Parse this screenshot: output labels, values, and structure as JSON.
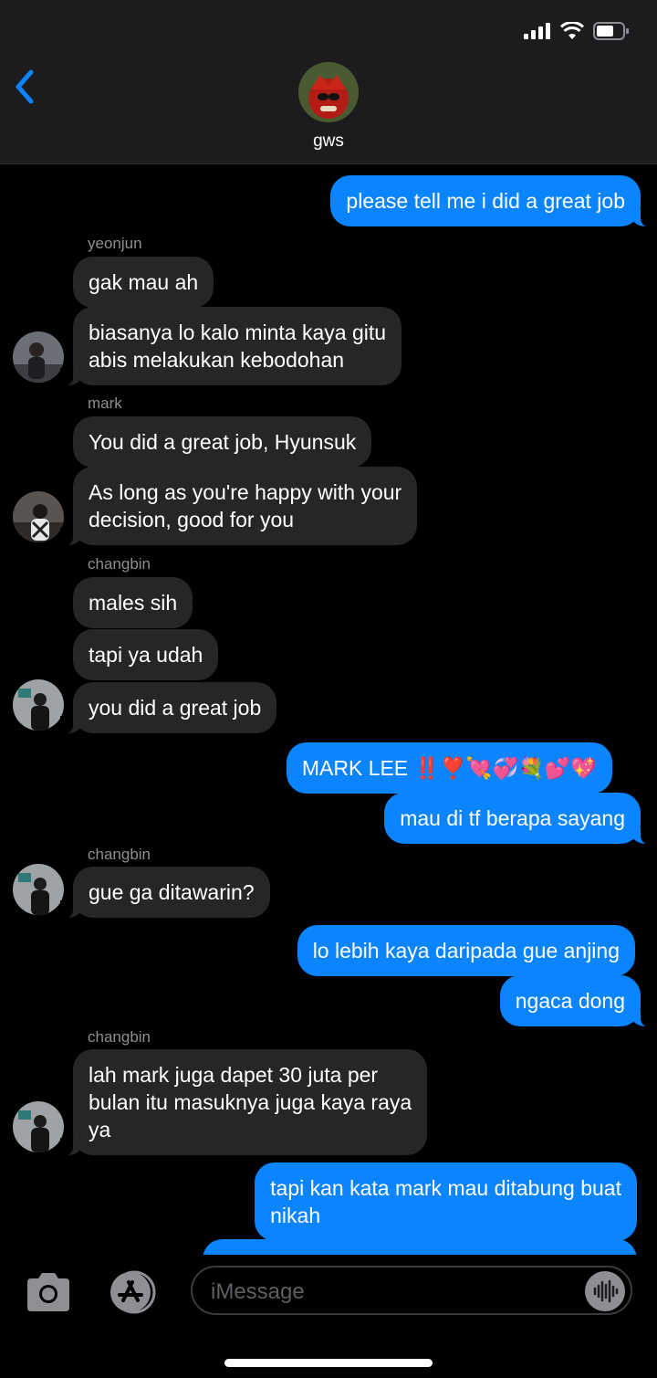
{
  "header": {
    "title": "gws",
    "back_icon": "chevron-left-icon",
    "avatar": "group-avatar-image"
  },
  "status": {
    "signal": "signal-icon",
    "wifi": "wifi-icon",
    "battery": "battery-icon"
  },
  "colors": {
    "sent_bubble": "#0a84ff",
    "received_bubble": "#262629",
    "background": "#000000",
    "header_bg": "#1c1c1e"
  },
  "messages": {
    "m1": "please tell me i did a great job",
    "s1": "yeonjun",
    "m2": "gak mau ah",
    "m3": "biasanya lo kalo minta kaya gitu\nabis melakukan kebodohan",
    "s2": "mark",
    "m4": "You did a great job, Hyunsuk",
    "m5": "As long as you're happy with your\ndecision, good for you",
    "s3": "changbin",
    "m6": "males sih",
    "m7": "tapi ya udah",
    "m8": "you did a great job",
    "m9": "MARK LEE ‼️❣️💘💞💐💕💖",
    "m10": "mau di tf berapa sayang",
    "s4": "changbin",
    "m11": "gue ga ditawarin?",
    "m12": "lo lebih kaya daripada gue anjing",
    "m13": "ngaca dong",
    "s5": "changbin",
    "m14": "lah mark juga dapet 30 juta per\nbulan itu masuknya juga kaya raya\nya",
    "m15": "tapi kan kata mark mau ditabung buat\nnikah"
  },
  "input": {
    "placeholder": "iMessage",
    "camera_icon": "camera-icon",
    "apps_icon": "app-store-icon",
    "audio_icon": "audio-waveform-icon"
  }
}
